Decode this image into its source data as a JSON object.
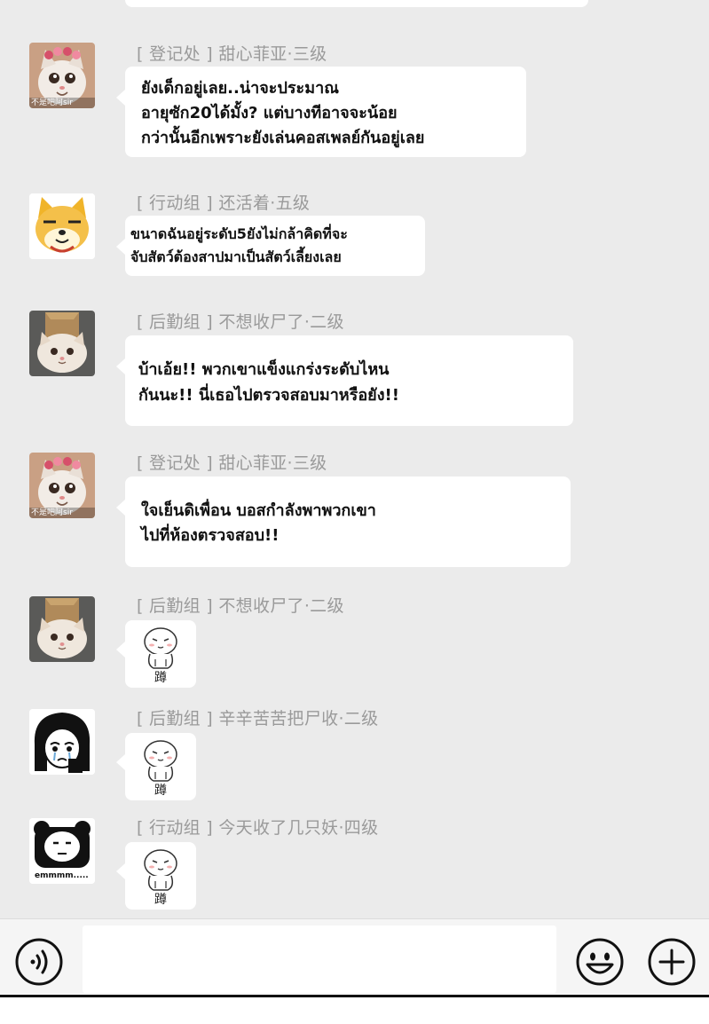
{
  "messages": [
    {
      "sender": "[ 登记处 ] 甜心菲亚·三级",
      "avatar_icon": "cat-with-flower-crown-avatar",
      "avatar_caption": "不是吧阿sir",
      "lines": [
        "ยังเด็กอยู่เลย..น่าจะประมาณ",
        "อายุซัก20ได้มั้ง? แต่บางทีอาจจะน้อย",
        "กว่านั้นอีกเพราะยังเล่นคอสเพลย์กันอยู่เลย"
      ]
    },
    {
      "sender": "[ 行动组 ] 还活着·五级",
      "avatar_icon": "doge-shiba-avatar",
      "lines": [
        "ขนาดฉันอยู่ระดับ5ยังไม่กล้าคิดที่จะ",
        "จับสัตว์ต้องสาปมาเป็นสัตว์เลี้ยงเลย"
      ]
    },
    {
      "sender": "[ 后勤组 ] 不想收尸了·二级",
      "avatar_icon": "cat-in-box-avatar",
      "lines": [
        "บ้าเอ้ย!! พวกเขาแข็งแกร่งระดับไหน",
        "กันนะ!! นี่เธอไปตรวจสอบมาหรือยัง!!"
      ]
    },
    {
      "sender": "[ 登记处 ] 甜心菲亚·三级",
      "avatar_icon": "cat-with-flower-crown-avatar",
      "avatar_caption": "不是吧阿sir",
      "lines": [
        "ใจเย็นดิเพื่อน บอสกำลังพาพวกเขา",
        "ไปที่ห้องตรวจสอบ!!"
      ]
    },
    {
      "sender": "[ 后勤组 ] 不想收尸了·二级",
      "avatar_icon": "cat-in-box-avatar",
      "sticker_label": "蹲",
      "sticker_icon": "squatting-figure-sticker"
    },
    {
      "sender": "[ 后勤组 ] 辛辛苦苦把尸收·二级",
      "avatar_icon": "crying-manga-girl-avatar",
      "sticker_label": "蹲",
      "sticker_icon": "squatting-figure-sticker"
    },
    {
      "sender": "[ 行动组 ] 今天收了几只妖·四级",
      "avatar_icon": "panda-meme-avatar",
      "avatar_caption": "emmmm.....",
      "sticker_label": "蹲",
      "sticker_icon": "squatting-figure-sticker"
    }
  ],
  "input_bar": {
    "voice_icon": "voice-icon",
    "emoji_icon": "emoji-icon",
    "plus_icon": "plus-icon",
    "message_value": ""
  },
  "colors": {
    "chat_background": "#ebebeb",
    "bubble": "#ffffff",
    "sender_text": "#9a9a9a",
    "message_text": "#111111"
  }
}
